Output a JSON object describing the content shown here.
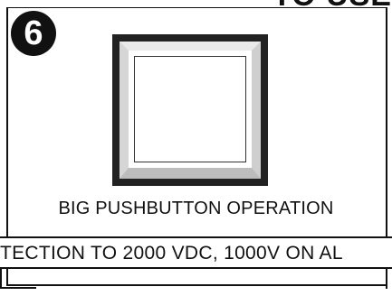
{
  "page": {
    "top_clip_text": "TO USE",
    "badge_number": "6",
    "caption": "BIG PUSHBUTTON OPERATION",
    "banner_text": "TECTION TO 2000 VDC, 1000V ON AL"
  },
  "colors": {
    "ink": "#111111",
    "paper": "#ffffff"
  }
}
